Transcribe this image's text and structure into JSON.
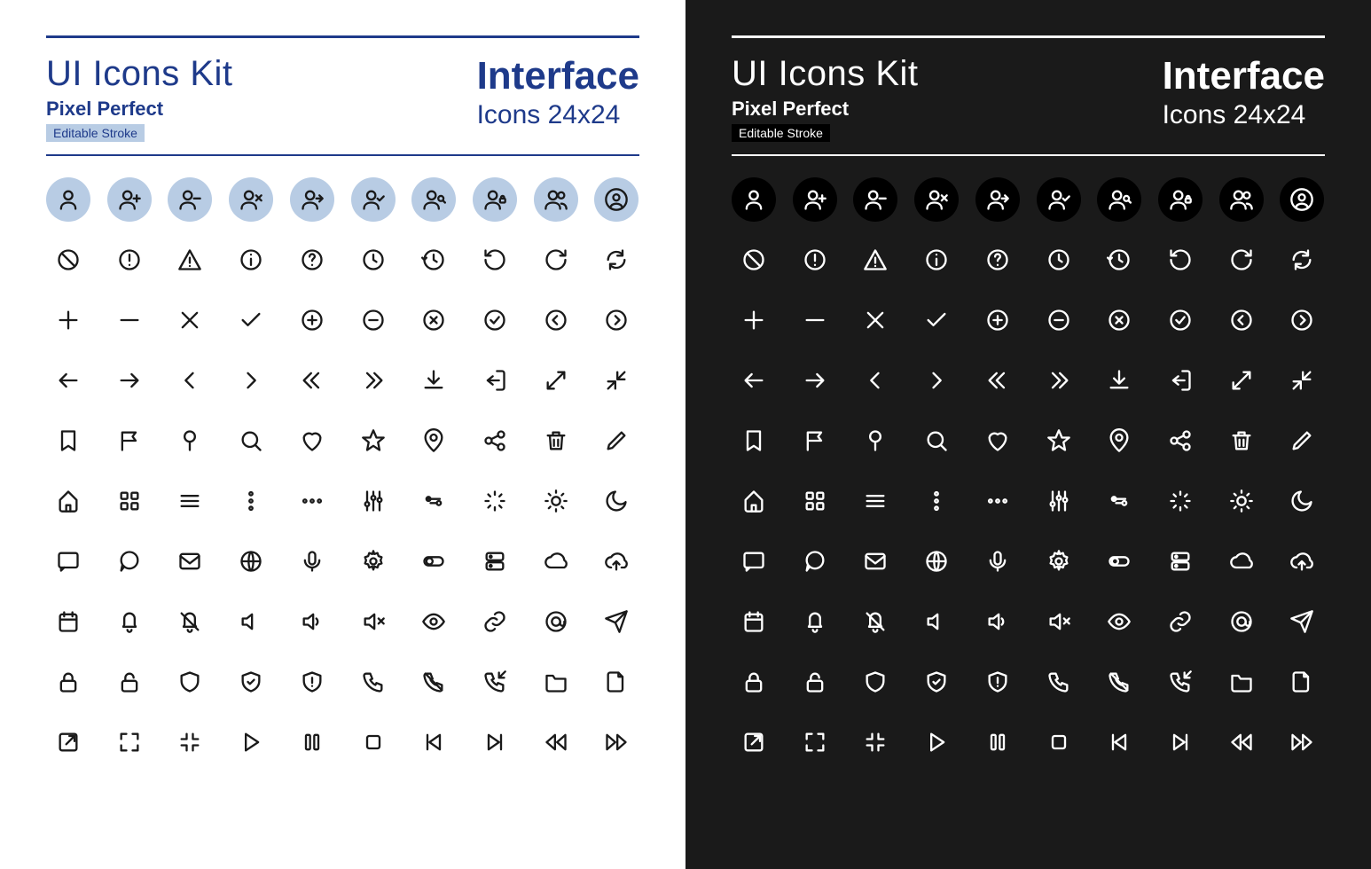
{
  "header": {
    "kit_title": "UI Icons Kit",
    "subtitle": "Pixel Perfect",
    "editable": "Editable Stroke",
    "category": "Interface",
    "size_label": "Icons 24x24"
  },
  "colors": {
    "light_accent": "#1e3a8a",
    "light_highlight": "#b8cce4",
    "dark_bg": "#1a1a1a",
    "dark_circle": "#000000"
  },
  "icons": [
    [
      "user",
      "user-add",
      "user-remove",
      "user-delete",
      "user-forward",
      "user-check",
      "user-search",
      "user-lock",
      "users",
      "user-circle"
    ],
    [
      "ban",
      "alert-circle",
      "alert-triangle",
      "info",
      "help",
      "clock",
      "history",
      "rotate-ccw",
      "rotate-cw",
      "refresh"
    ],
    [
      "plus",
      "minus",
      "x",
      "check",
      "plus-circle",
      "minus-circle",
      "x-circle",
      "check-circle",
      "chevron-left-circle",
      "chevron-right-circle"
    ],
    [
      "arrow-left",
      "arrow-right",
      "chevron-left",
      "chevron-right",
      "chevrons-left",
      "chevrons-right",
      "download",
      "exit",
      "expand",
      "collapse"
    ],
    [
      "bookmark",
      "flag",
      "pin",
      "search",
      "heart",
      "star",
      "location",
      "share",
      "trash",
      "edit"
    ],
    [
      "home",
      "grid",
      "menu",
      "more-vertical",
      "more-horizontal",
      "sliders",
      "filter",
      "loading",
      "sun",
      "moon"
    ],
    [
      "message-square",
      "message-circle",
      "mail",
      "globe",
      "mic",
      "settings",
      "toggle",
      "server",
      "cloud",
      "cloud-upload"
    ],
    [
      "calendar",
      "bell",
      "bell-off",
      "volume",
      "volume-low",
      "volume-x",
      "eye",
      "link",
      "at-sign",
      "send"
    ],
    [
      "lock",
      "unlock",
      "shield",
      "shield-check",
      "shield-alert",
      "phone",
      "phone-off",
      "phone-incoming",
      "folder",
      "file"
    ],
    [
      "external-link",
      "maximize",
      "minimize",
      "play",
      "pause",
      "stop",
      "skip-back",
      "skip-forward",
      "rewind",
      "fast-forward"
    ]
  ]
}
